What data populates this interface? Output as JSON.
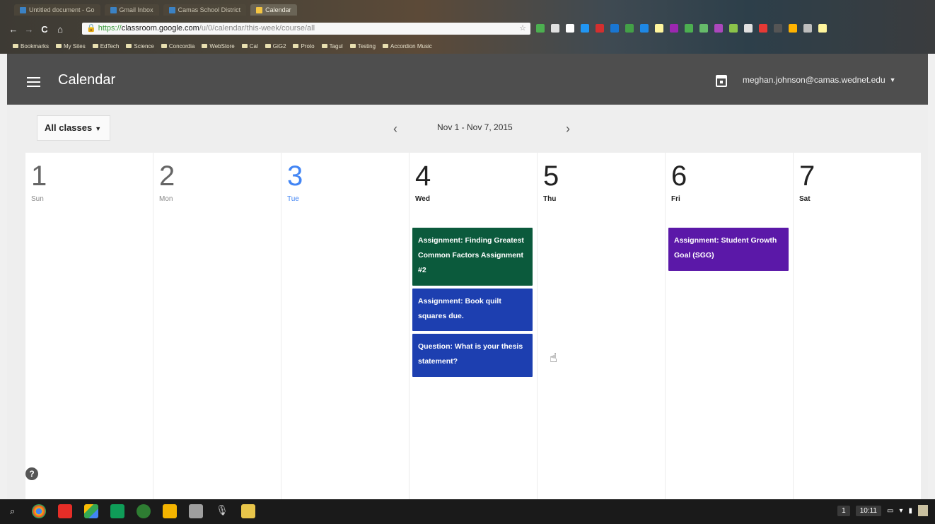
{
  "browser": {
    "tabs": [
      {
        "label": "Untitled document - Go"
      },
      {
        "label": "Gmail Inbox"
      },
      {
        "label": "Camas School District"
      },
      {
        "label": "Calendar",
        "active": true
      }
    ],
    "url_lock": "🔒",
    "url_scheme": "https://",
    "url_host": "classroom.google.com",
    "url_path": "/u/0/calendar/this-week/course/all",
    "bookmarks": [
      "Bookmarks",
      "My Sites",
      "EdTech",
      "Science",
      "Concordia",
      "WebStore",
      "Cal",
      "GiG2",
      "Proto",
      "Tagul",
      "Testing",
      "Accordion Music"
    ]
  },
  "appbar": {
    "title": "Calendar",
    "account": "meghan.johnson@camas.wednet.edu"
  },
  "filters": {
    "class_select": "All classes"
  },
  "week_nav": {
    "prev": "‹",
    "range": "Nov 1 - Nov 7, 2015",
    "next": "›"
  },
  "days": [
    {
      "num": "1",
      "name": "Sun"
    },
    {
      "num": "2",
      "name": "Mon"
    },
    {
      "num": "3",
      "name": "Tue"
    },
    {
      "num": "4",
      "name": "Wed"
    },
    {
      "num": "5",
      "name": "Thu"
    },
    {
      "num": "6",
      "name": "Fri"
    },
    {
      "num": "7",
      "name": "Sat"
    }
  ],
  "events": {
    "wed_1": "Assignment: Finding Greatest Common Factors Assignment #2",
    "wed_2": "Assignment: Book quilt squares due.",
    "wed_3": "Question: What is your thesis statement?",
    "fri_1": "Assignment: Student Growth Goal (SGG)"
  },
  "colors": {
    "today": "#4285f4",
    "event_green": "#0b5a3c",
    "event_blue": "#1d3fb0",
    "event_purple": "#5b18a8",
    "appbar": "#4e4e4e"
  },
  "help_label": "?",
  "taskbar": {
    "badge": "1",
    "time": "10:11"
  }
}
